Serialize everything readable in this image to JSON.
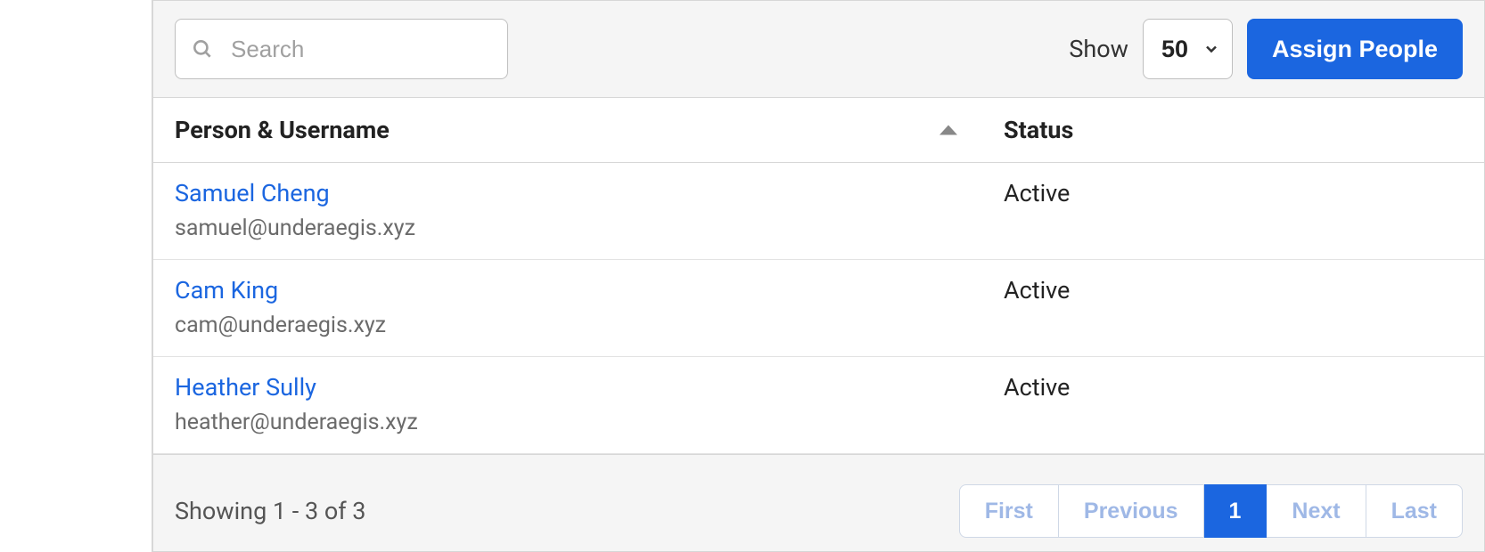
{
  "toolbar": {
    "search_placeholder": "Search",
    "show_label": "Show",
    "page_size_value": "50",
    "assign_label": "Assign People"
  },
  "table": {
    "headers": {
      "person": "Person & Username",
      "status": "Status"
    },
    "rows": [
      {
        "name": "Samuel Cheng",
        "email": "samuel@underaegis.xyz",
        "status": "Active"
      },
      {
        "name": "Cam King",
        "email": "cam@underaegis.xyz",
        "status": "Active"
      },
      {
        "name": "Heather Sully",
        "email": "heather@underaegis.xyz",
        "status": "Active"
      }
    ]
  },
  "footer": {
    "showing_text": "Showing 1 - 3 of 3",
    "pager": {
      "first": "First",
      "previous": "Previous",
      "current": "1",
      "next": "Next",
      "last": "Last"
    }
  }
}
